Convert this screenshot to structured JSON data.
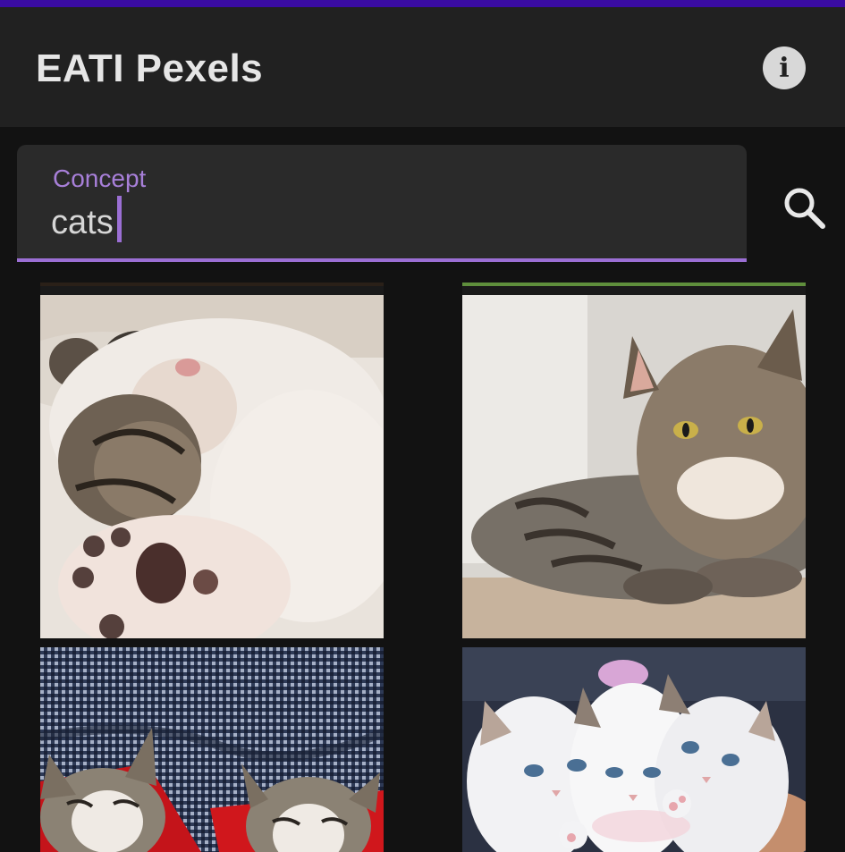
{
  "app": {
    "title": "EATI Pexels",
    "info_icon": "info-icon"
  },
  "search": {
    "label": "Concept",
    "value": "cats",
    "search_icon": "search-icon"
  },
  "results": [
    {
      "subject": "kitten sleeping on back with paw"
    },
    {
      "subject": "tabby cat lying on floor"
    },
    {
      "subject": "two tabby kittens sleeping under red blanket"
    },
    {
      "subject": "three white fluffy kittens"
    }
  ],
  "colors": {
    "status_bar": "#3a0ca3",
    "app_bar": "#212121",
    "background": "#121212",
    "accent": "#9b6fd4"
  }
}
